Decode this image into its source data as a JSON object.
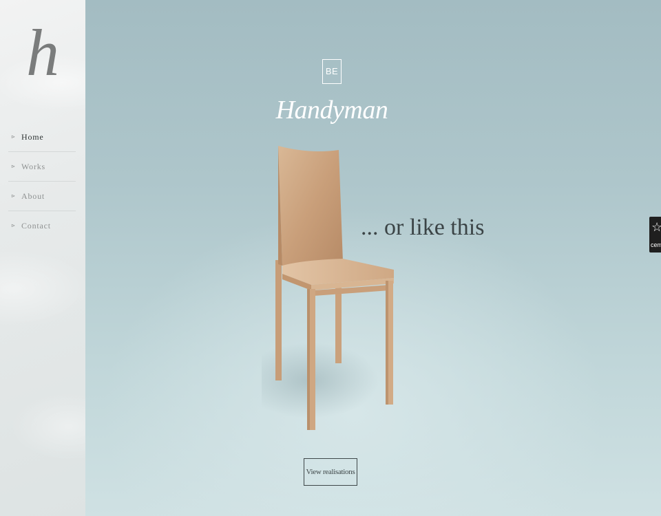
{
  "sidebar": {
    "logo": "h",
    "nav": [
      {
        "label": "Home",
        "active": true
      },
      {
        "label": "Works",
        "active": false
      },
      {
        "label": "About",
        "active": false
      },
      {
        "label": "Contact",
        "active": false
      }
    ],
    "bullet_icon": "chevron-right-icon"
  },
  "hero": {
    "brand_mark": "BE",
    "brand_name": "Handyman",
    "tagline": "... or like this",
    "cta_label": "View realisations",
    "image": "wooden-chair"
  },
  "badge": {
    "icon": "star-icon",
    "text": "cem"
  },
  "colors": {
    "hero_top": "#a3bcc2",
    "hero_bottom": "#cfe1e3",
    "sidebar_bg": "#e7eaea",
    "text_dark": "#3b4446",
    "white": "#ffffff"
  }
}
